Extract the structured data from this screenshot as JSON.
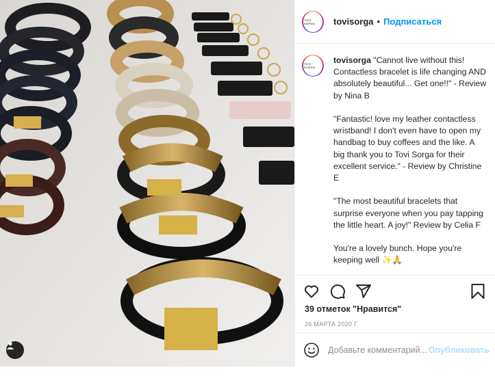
{
  "post": {
    "author": "tovisorga",
    "follow_label": "Подписаться",
    "dot": "•",
    "avatar_text": "TOVI SORGA",
    "caption": "\"Cannot live without this! Contactless bracelet is life changing AND absolutely beautiful... Get one!!\" - Review by Nina B\n\n\"Fantastic! love my leather contactless wristband! I don't even have to open my handbag to buy coffees and the like. A big thank you to Tovi Sorga for their excellent service.\" - Review by Christine E\n\n\"The most beautiful bracelets that surprise everyone when you pay tapping the little heart. A joy!\" Review by Celia F\n\nYou're a lovely bunch. Hope you're keeping well ✨🙏",
    "likes": "39 отметок \"Нравится\"",
    "date": "26 МАРТА 2020 Г.",
    "comment_placeholder": "Добавьте комментарий...",
    "publish_label": "Опубликовать"
  },
  "icons": {
    "like": "heart-icon",
    "comment": "comment-icon",
    "share": "share-icon",
    "save": "bookmark-icon",
    "emoji": "smiley-icon",
    "tags": "user-tag-icon"
  },
  "colors": {
    "link": "#0095f6",
    "publish_disabled": "#b2dffc",
    "muted": "#8e8e8e"
  }
}
